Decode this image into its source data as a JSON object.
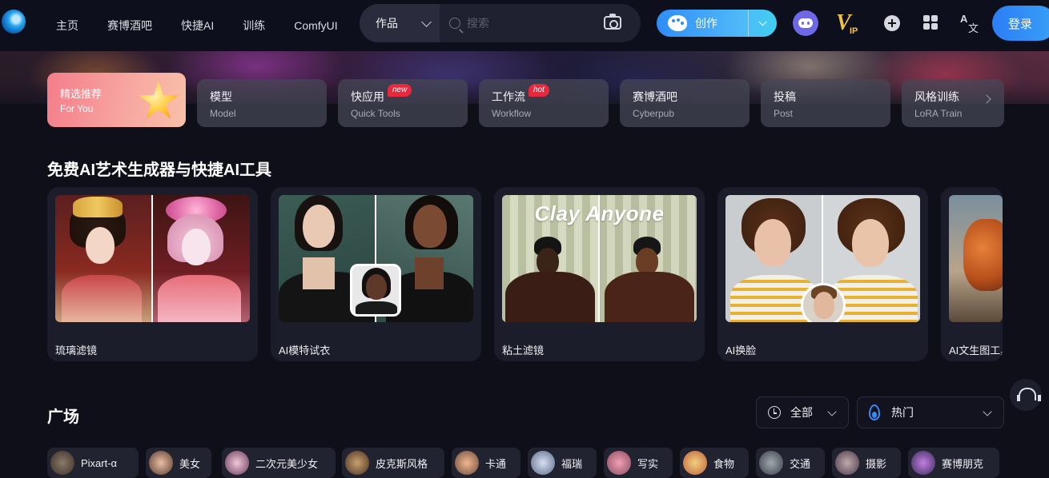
{
  "header": {
    "nav": [
      "主页",
      "赛博酒吧",
      "快捷AI",
      "训练",
      "ComfyUI"
    ],
    "search_type": "作品",
    "search_placeholder": "搜索",
    "create_label": "创作",
    "vip_label": "IP",
    "lang_glyph_a": "A",
    "lang_glyph_b": "文",
    "login_label": "登录"
  },
  "categories": [
    {
      "zh": "精选推荐",
      "en": "For You",
      "active": true
    },
    {
      "zh": "模型",
      "en": "Model"
    },
    {
      "zh": "快应用",
      "en": "Quick Tools",
      "badge": "new"
    },
    {
      "zh": "工作流",
      "en": "Workflow",
      "badge": "hot"
    },
    {
      "zh": "赛博酒吧",
      "en": "Cyberpub"
    },
    {
      "zh": "投稿",
      "en": "Post"
    },
    {
      "zh": "风格训练",
      "en": "LoRA Train"
    }
  ],
  "section_title": "免费AI艺术生成器与快捷AI工具",
  "tools": [
    {
      "label": "琉璃滤镜"
    },
    {
      "label": "AI模特试衣"
    },
    {
      "label": "粘土滤镜",
      "overlay_text": "Clay Anyone"
    },
    {
      "label": "AI换脸"
    },
    {
      "label": "AI文生图工具"
    }
  ],
  "plaza": {
    "title": "广场",
    "filter_time": "全部",
    "filter_sort": "热门",
    "tags": [
      "Pixart-α",
      "美女",
      "二次元美少女",
      "皮克斯风格",
      "卡通",
      "福瑞",
      "写实",
      "食物",
      "交通",
      "摄影",
      "赛博朋克"
    ]
  },
  "colors": {
    "accent": "#2f8df7",
    "active_tab": "#f47d8a",
    "badge": "#e8283c",
    "background": "#0f0f1a"
  }
}
